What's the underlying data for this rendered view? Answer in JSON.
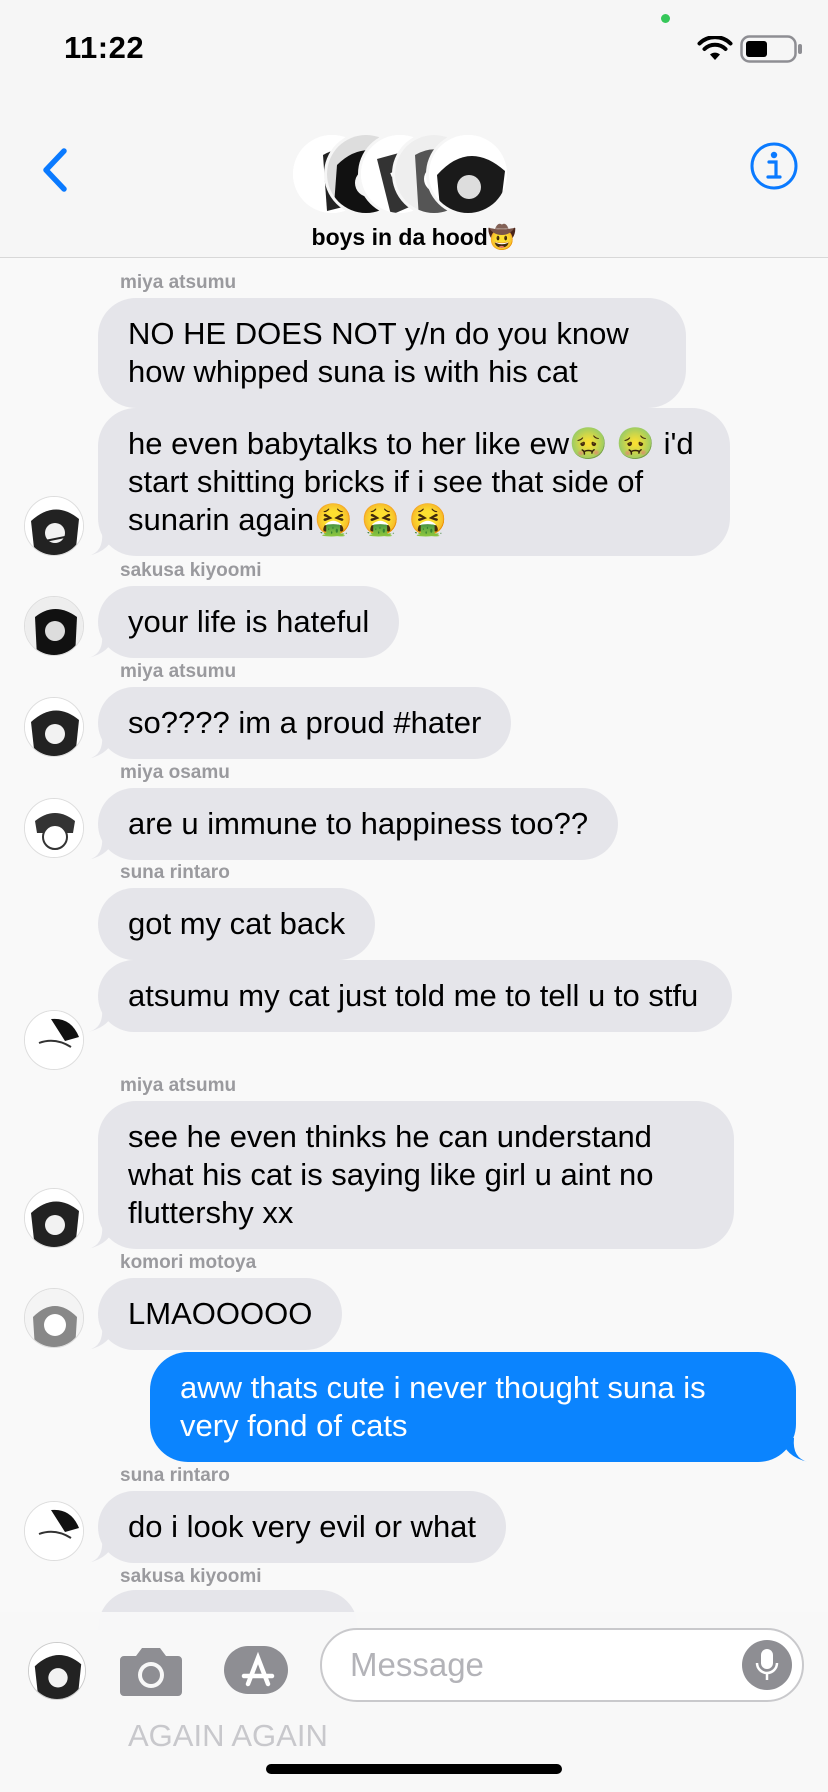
{
  "status": {
    "time": "11:22"
  },
  "header": {
    "group_name": "boys in da hood🤠"
  },
  "messages": [
    {
      "sender": "miya atsumu",
      "text": "NO HE DOES NOT y/n do you know how whipped suna is with his cat",
      "direction": "in"
    },
    {
      "sender": "",
      "text": "he even babytalks to her like ew🤢 🤢 i'd start shitting bricks if i see that side of sunarin again🤮 🤮 🤮",
      "direction": "in"
    },
    {
      "sender": "sakusa kiyoomi",
      "text": "your life is hateful",
      "direction": "in"
    },
    {
      "sender": "miya atsumu",
      "text": "so???? im a proud #hater",
      "direction": "in"
    },
    {
      "sender": "miya osamu",
      "text": "are u immune to happiness too??",
      "direction": "in"
    },
    {
      "sender": "suna rintaro",
      "text": "got my cat back",
      "direction": "in"
    },
    {
      "sender": "",
      "text": "atsumu my cat just told me to tell u to stfu",
      "direction": "in"
    },
    {
      "sender": "miya atsumu",
      "text": "see he even thinks he can understand what his cat is saying  like girl u aint no fluttershy xx",
      "direction": "in"
    },
    {
      "sender": "komori motoya",
      "text": "LMAOOOOO",
      "direction": "in"
    },
    {
      "sender": "",
      "text": "aww thats cute i never thought suna is very fond of cats",
      "direction": "out"
    },
    {
      "sender": "suna rintaro",
      "text": "do i look very evil or what",
      "direction": "in"
    },
    {
      "sender": "sakusa kiyoomi",
      "text": "",
      "direction": "in"
    }
  ],
  "input": {
    "placeholder": "Message",
    "ghost_text": "AGAIN AGAIN"
  },
  "colors": {
    "outgoing_bubble": "#0b84fe",
    "incoming_bubble": "#e5e5ea",
    "accent": "#0a7aff"
  },
  "icons": [
    "back-chevron-icon",
    "info-icon",
    "camera-icon",
    "app-store-icon",
    "microphone-icon",
    "wifi-icon",
    "battery-icon"
  ]
}
